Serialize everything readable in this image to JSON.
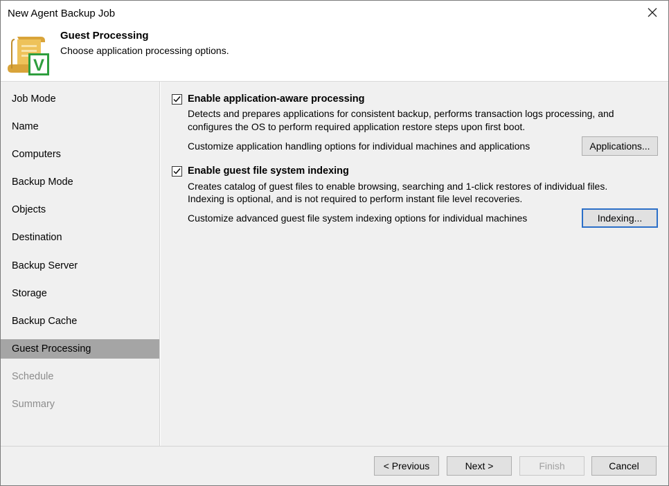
{
  "window": {
    "title": "New Agent Backup Job"
  },
  "header": {
    "title": "Guest Processing",
    "subtitle": "Choose application processing options.",
    "icon_letter": "V"
  },
  "steps": [
    {
      "label": "Job Mode",
      "state": "normal"
    },
    {
      "label": "Name",
      "state": "normal"
    },
    {
      "label": "Computers",
      "state": "normal"
    },
    {
      "label": "Backup Mode",
      "state": "normal"
    },
    {
      "label": "Objects",
      "state": "normal"
    },
    {
      "label": "Destination",
      "state": "normal"
    },
    {
      "label": "Backup Server",
      "state": "normal"
    },
    {
      "label": "Storage",
      "state": "normal"
    },
    {
      "label": "Backup Cache",
      "state": "normal"
    },
    {
      "label": "Guest Processing",
      "state": "active"
    },
    {
      "label": "Schedule",
      "state": "disabled"
    },
    {
      "label": "Summary",
      "state": "disabled"
    }
  ],
  "app_aware": {
    "label": "Enable application-aware processing",
    "checked": true,
    "description_line1": "Detects and prepares applications for consistent backup, performs transaction logs processing, and",
    "description_line2": "configures the OS to perform required application restore steps upon first boot.",
    "customize_text": "Customize application handling options for individual machines and applications",
    "button_label": "Applications..."
  },
  "indexing": {
    "label": "Enable guest file system indexing",
    "checked": true,
    "description_line1": "Creates catalog of guest files to enable browsing, searching and 1-click restores of individual files.",
    "description_line2": "Indexing is optional, and is not required to perform instant file level recoveries.",
    "customize_text": "Customize advanced guest file system indexing options for individual machines",
    "button_label": "Indexing..."
  },
  "footer": {
    "previous": "< Previous",
    "next": "Next >",
    "finish": "Finish",
    "cancel": "Cancel"
  },
  "colors": {
    "sidebar_bg": "#f0f0f0",
    "active_step_bg": "#a5a5a5",
    "focus_border": "#2b6fc8",
    "icon_scroll": "#e7b84a",
    "icon_check": "#2e9e3e"
  }
}
